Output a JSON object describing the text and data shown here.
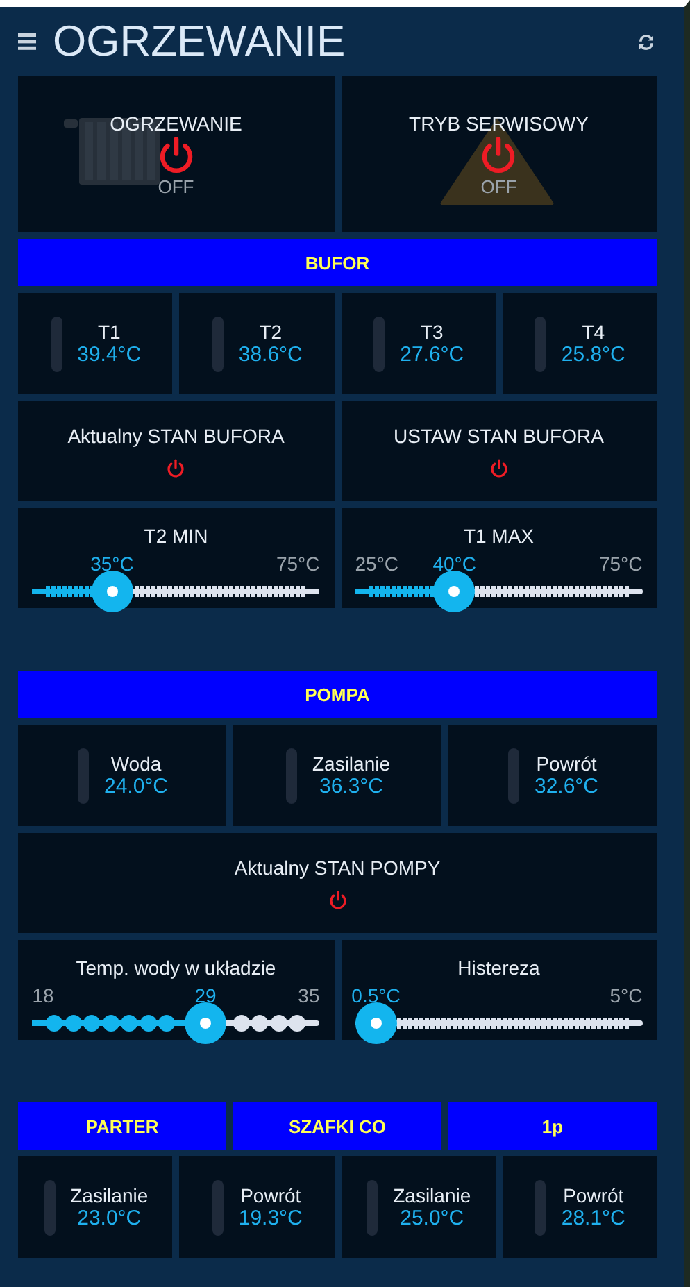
{
  "header": {
    "title": "OGRZEWANIE"
  },
  "switches": [
    {
      "kind": "radiator",
      "label": "OGRZEWANIE",
      "on": false,
      "status": "OFF"
    },
    {
      "kind": "warning",
      "label": "TRYB SERWISOWY",
      "on": false,
      "status": "OFF"
    }
  ],
  "bufor": {
    "title": "BUFOR",
    "sensors": [
      {
        "label": "T1",
        "value": "39.4°C"
      },
      {
        "label": "T2",
        "value": "38.6°C"
      },
      {
        "label": "T3",
        "value": "27.6°C"
      },
      {
        "label": "T4",
        "value": "25.8°C"
      }
    ],
    "states": [
      {
        "label": "Aktualny STAN BUFORA",
        "on": false
      },
      {
        "label": "USTAW STAN BUFORA",
        "on": false
      }
    ],
    "sliders": [
      {
        "kind": "dense",
        "label": "T2 MIN",
        "value": "35°C",
        "max": "75°C",
        "level": 0.24
      },
      {
        "kind": "dense",
        "label": "T1 MAX",
        "min": "25°C",
        "value": "40°C",
        "max": "75°C",
        "level": 0.32
      }
    ]
  },
  "pompa": {
    "title": "POMPA",
    "sensors": [
      {
        "label": "Woda",
        "value": "24.0°C"
      },
      {
        "label": "Zasilanie",
        "value": "36.3°C"
      },
      {
        "label": "Powrót",
        "value": "32.6°C"
      }
    ],
    "states": [
      {
        "label": "Aktualny STAN POMPY",
        "on": false
      }
    ],
    "sliders": [
      {
        "kind": "dots",
        "label": "Temp. wody w układzie",
        "min": "18",
        "value": "29",
        "max": "35",
        "level": 0.62
      },
      {
        "kind": "dense",
        "label": "Histereza",
        "value": "0.5°C",
        "max": "5°C",
        "level": 0
      }
    ]
  },
  "circuits": {
    "headers": [
      "PARTER",
      "SZAFKI CO",
      "1p"
    ],
    "sensors": [
      {
        "label": "Zasilanie",
        "value": "23.0°C"
      },
      {
        "label": "Powrót",
        "value": "19.3°C"
      },
      {
        "label": "Zasilanie",
        "value": "25.0°C"
      },
      {
        "label": "Powrót",
        "value": "28.1°C"
      }
    ]
  }
}
